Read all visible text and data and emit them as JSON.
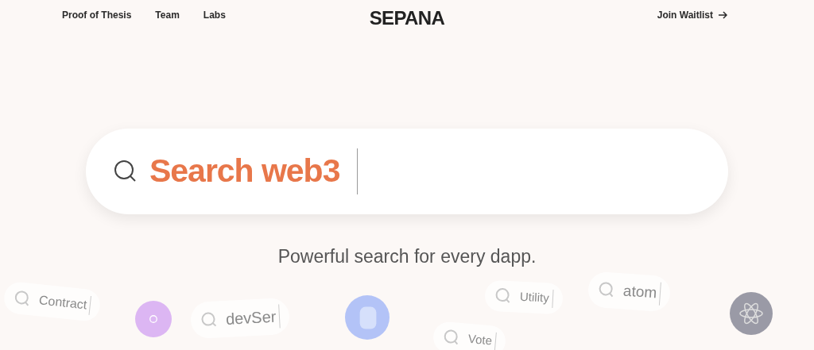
{
  "nav": {
    "links": [
      "Proof of Thesis",
      "Team",
      "Labs"
    ],
    "logo": "SEPANA",
    "cta": "Join Waitlist"
  },
  "search": {
    "value": "Search web3"
  },
  "tagline": "Powerful search for every dapp.",
  "floating_searches": [
    {
      "text": "Contract"
    },
    {
      "text": "devSer"
    },
    {
      "text": "Utility"
    },
    {
      "text": "atom"
    },
    {
      "text": "Vote"
    }
  ]
}
